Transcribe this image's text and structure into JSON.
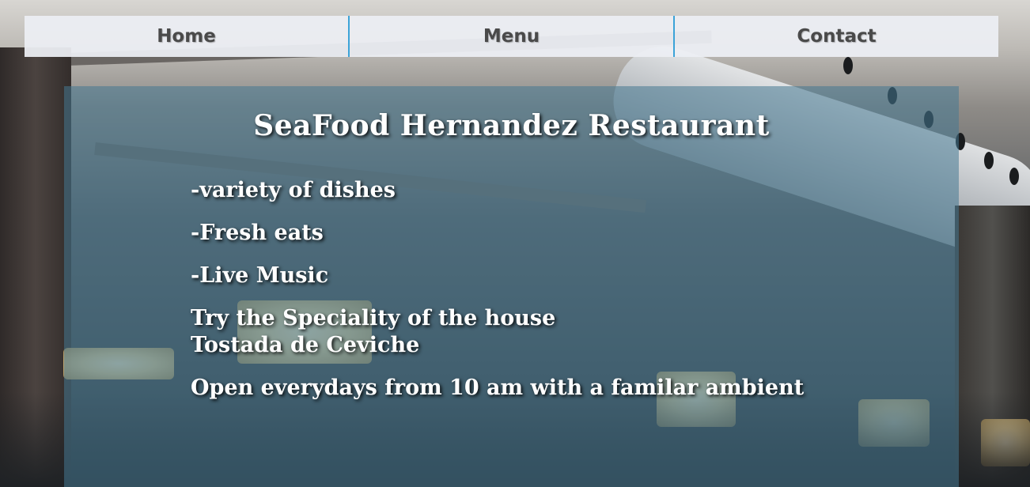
{
  "nav": {
    "items": [
      {
        "label": "Home"
      },
      {
        "label": "Menu"
      },
      {
        "label": "Contact"
      }
    ],
    "separator_color": "#3ba3d8"
  },
  "hero": {
    "title": "SeaFood Hernandez Restaurant",
    "features": [
      "-variety of dishes",
      "-Fresh eats",
      "-Live Music"
    ],
    "speciality_line1": "Try the Speciality of the house",
    "speciality_line2": "Tostada de Ceviche",
    "hours": "Open everydays from 10 am with a familar ambient"
  }
}
